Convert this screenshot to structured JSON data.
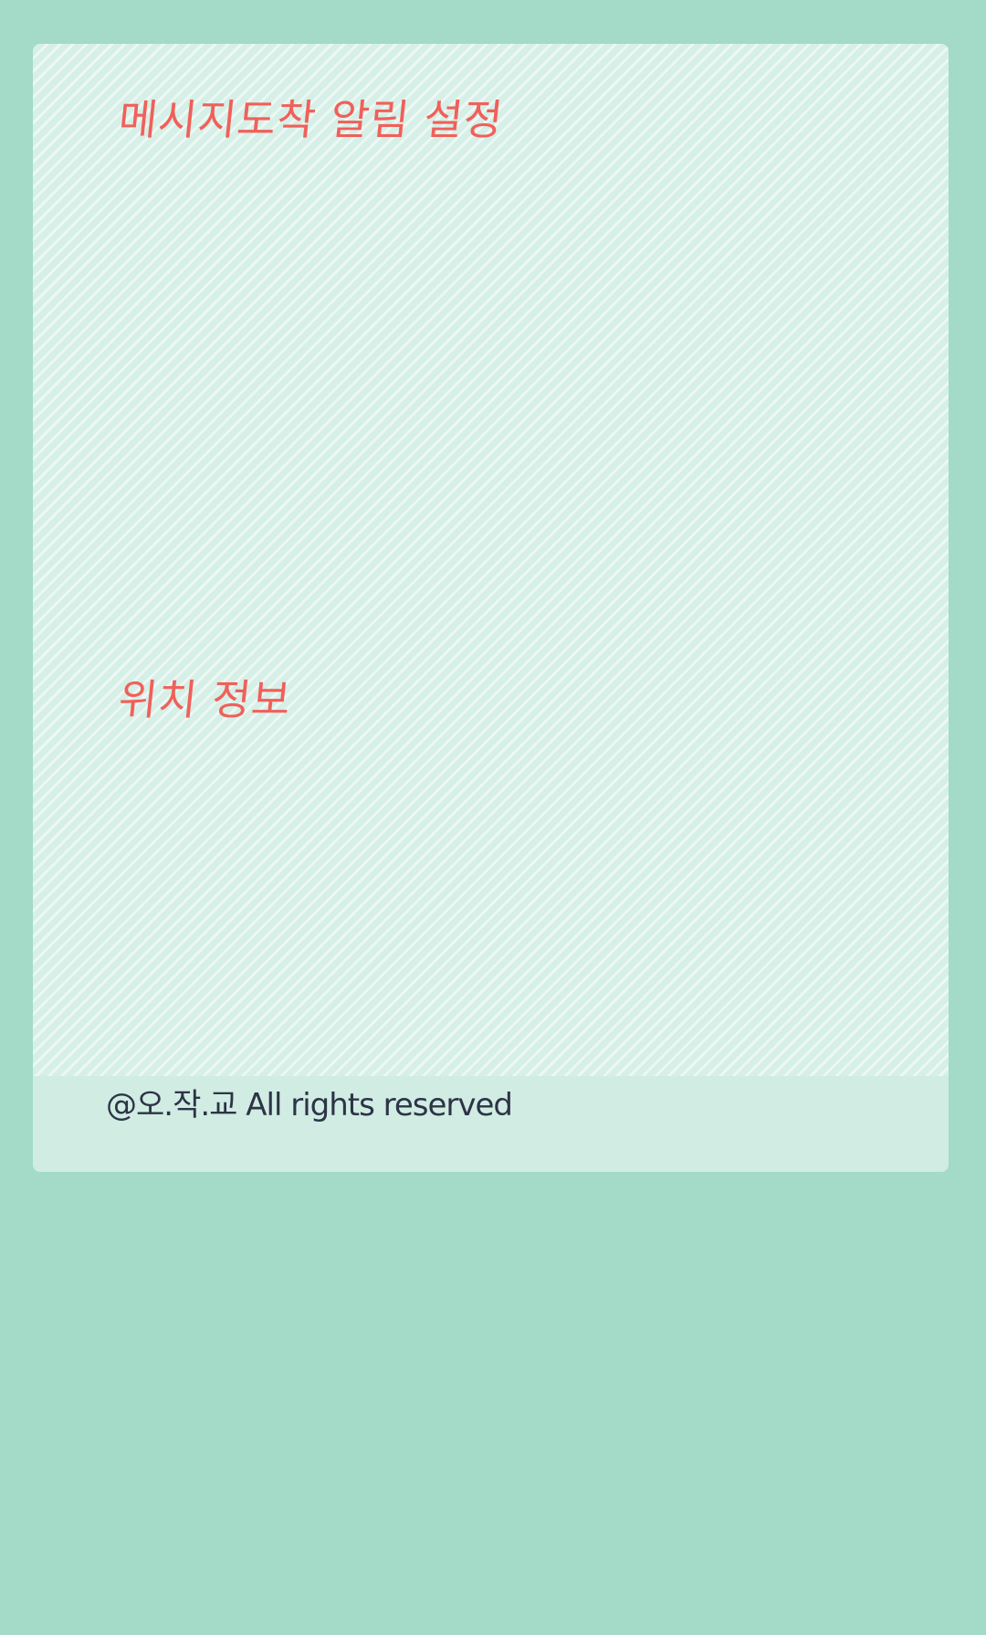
{
  "sections": {
    "notification": {
      "title": "메시지도착 알림 설정"
    },
    "location": {
      "title": "위치 정보"
    }
  },
  "footer": {
    "copyright": "@오.작.교 All rights reserved"
  },
  "colors": {
    "page_background": "#a3dac8",
    "card_background": "#d6efe7",
    "footer_background": "#d1ece3",
    "section_title": "#f0605a",
    "footer_text": "#2c3446"
  }
}
